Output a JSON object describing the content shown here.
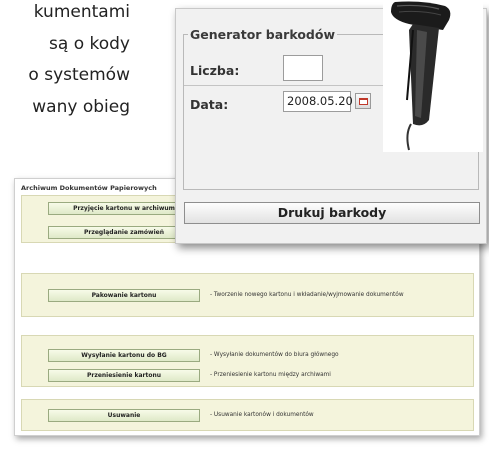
{
  "article": {
    "lines": [
      "kumentami",
      "są o kody",
      "o systemów",
      "wany obieg"
    ]
  },
  "archive_window": {
    "title": "Archiwum Dokumentów Papierowych",
    "rows": [
      {
        "button": "Przyjęcie kartonu w archiwum",
        "description": ""
      },
      {
        "button": "Przeglądanie zamówień",
        "description": ""
      },
      {
        "button": "Pakowanie kartonu",
        "description": "- Tworzenie nowego kartonu i wkładanie/wyjmowanie dokumentów"
      },
      {
        "button": "Wysyłanie kartonu do BG",
        "description": "- Wysyłanie dokumentów do biura głównego"
      },
      {
        "button": "Przeniesienie kartonu",
        "description": "- Przeniesienie kartonu między archiwami"
      },
      {
        "button": "Usuwanie",
        "description": "- Usuwanie kartonów i dokumentów"
      }
    ]
  },
  "barcode_generator": {
    "title": "Generator barkodów",
    "count_label": "Liczba:",
    "count_value": "",
    "date_label": "Data:",
    "date_value": "2008.05.20",
    "print_button": "Drukuj barkody"
  },
  "colors": {
    "panel_bg": "#f4f4dc",
    "button_green": "#dfe9c8",
    "window_bg": "#f1f1f1"
  }
}
